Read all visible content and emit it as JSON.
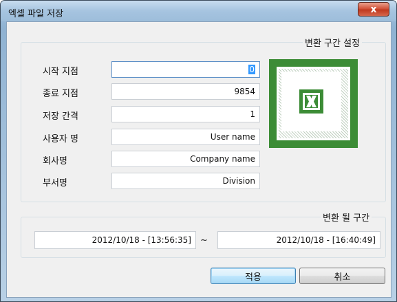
{
  "window": {
    "title": "엑셀 파일 저장",
    "close_glyph": "x"
  },
  "range_settings": {
    "title": "변환 구간 설정",
    "fields": [
      {
        "label": "시작 지점",
        "value": "0"
      },
      {
        "label": "종료 지점",
        "value": "9854"
      },
      {
        "label": "저장 간격",
        "value": "1"
      },
      {
        "label": "사용자 명",
        "value": "User name"
      },
      {
        "label": "회사명",
        "value": "Company name"
      },
      {
        "label": "부서명",
        "value": "Division"
      }
    ]
  },
  "excel_icon": {
    "name": "excel-logo-icon",
    "color": "#3c8c36"
  },
  "converted_range": {
    "title": "변환 될 구간",
    "start": "2012/10/18 - [13:56:35]",
    "separator": "~",
    "end": "2012/10/18 - [16:40:49]"
  },
  "buttons": {
    "apply": "적용",
    "cancel": "취소"
  }
}
